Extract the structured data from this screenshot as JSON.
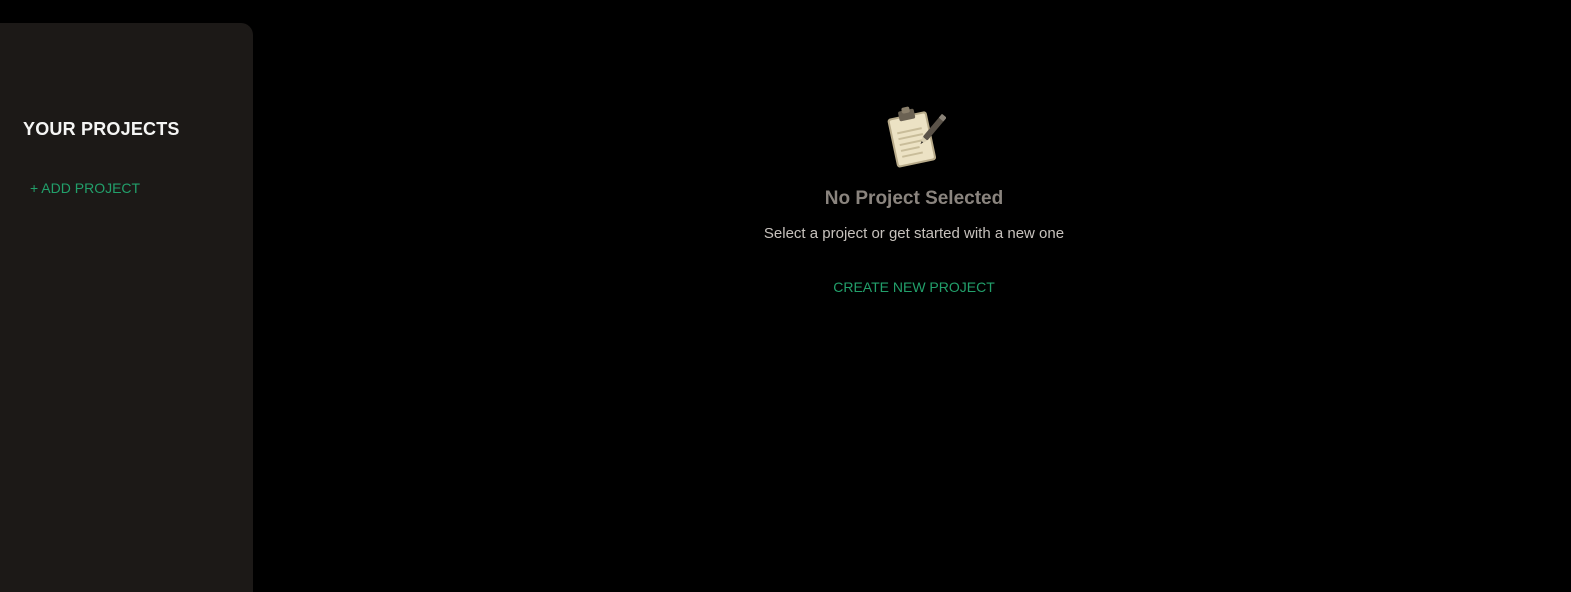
{
  "sidebar": {
    "title": "YOUR PROJECTS",
    "add_project_label": "+ ADD PROJECT"
  },
  "main": {
    "empty_state": {
      "icon": "clipboard-icon",
      "title": "No Project Selected",
      "subtitle": "Select a project or get started with a new one",
      "create_label": "CREATE NEW PROJECT"
    }
  },
  "colors": {
    "background": "#000000",
    "sidebar": "#1c1917",
    "accent": "#22a06b",
    "title_muted": "#8a847e",
    "subtitle": "#c7c2bd"
  }
}
